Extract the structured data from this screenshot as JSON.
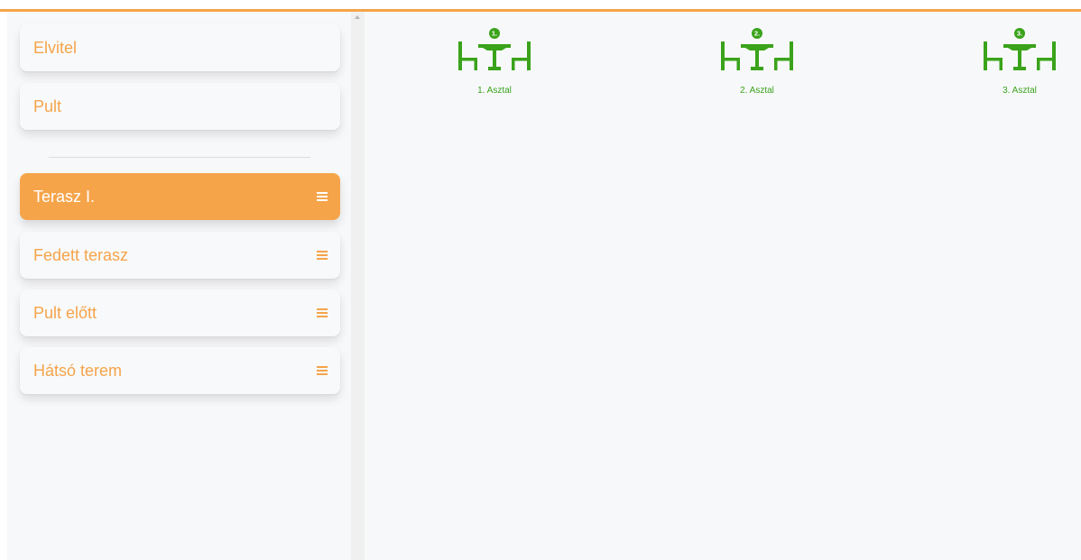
{
  "sidebar": {
    "fixed_items": [
      {
        "label": "Elvitel"
      },
      {
        "label": "Pult"
      }
    ],
    "sections": [
      {
        "label": "Terasz I.",
        "active": true
      },
      {
        "label": "Fedett terasz",
        "active": false
      },
      {
        "label": "Pult előtt",
        "active": false
      },
      {
        "label": "Hátsó terem",
        "active": false
      }
    ]
  },
  "tables": [
    {
      "number": "1.",
      "label": "1. Asztal"
    },
    {
      "number": "2.",
      "label": "2. Asztal"
    },
    {
      "number": "3.",
      "label": "3. Asztal"
    }
  ],
  "colors": {
    "accent": "#f5a44a",
    "table_green": "#3aa31b",
    "background": "#f7f8fa"
  },
  "icons": {
    "section_menu": "hamburger-icon",
    "table": "dining-table-icon",
    "scroll_up": "scroll-up-arrow-icon"
  }
}
